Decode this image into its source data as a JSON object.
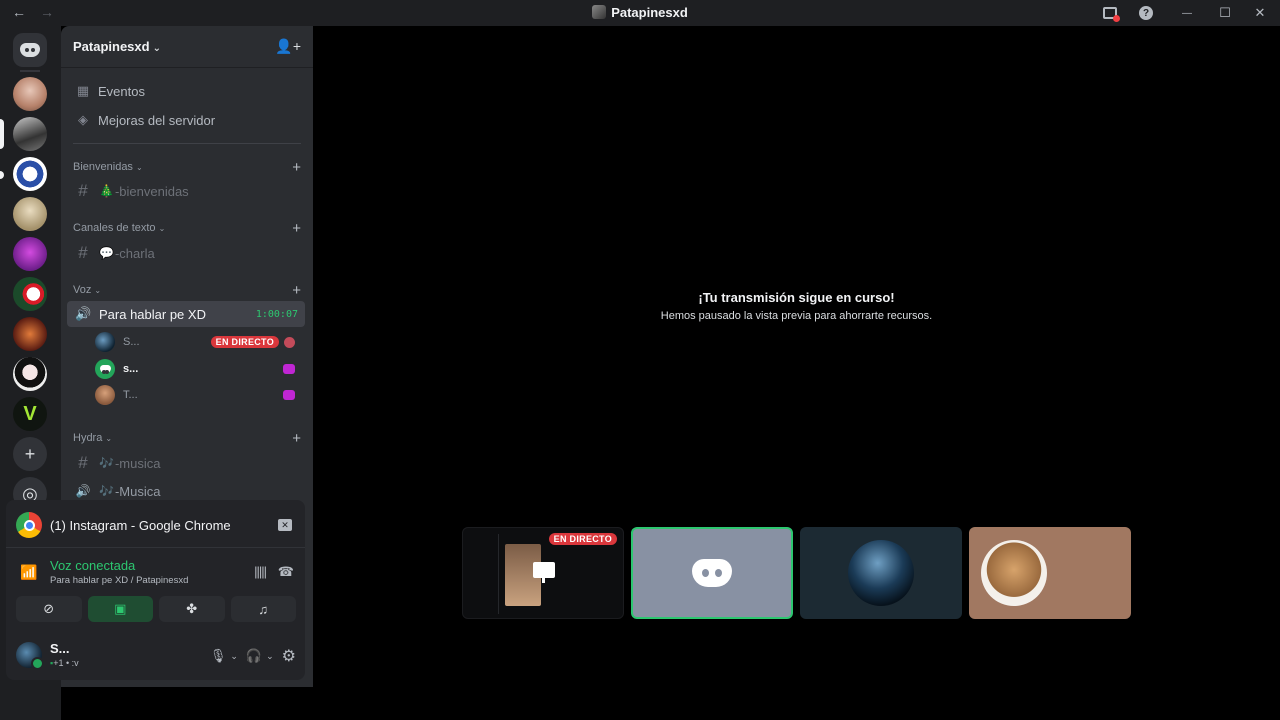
{
  "window": {
    "title": "Patapinesxd",
    "back_glyph": "←",
    "forward_glyph": "→",
    "minimize_glyph": "—",
    "maximize_glyph": "☐",
    "close_glyph": "✕",
    "help_glyph": "?"
  },
  "rail": {
    "add_glyph": "+",
    "discover_glyph": "◎"
  },
  "guild": {
    "name": "Patapinesxd",
    "chevron": "⌄",
    "invite_glyph": "👤+"
  },
  "nav": {
    "events_label": "Eventos",
    "boosts_label": "Mejoras del servidor"
  },
  "categories": [
    {
      "name": "Bienvenidas",
      "channels": [
        {
          "emoji": "🎄",
          "name": "-bienvenidas"
        }
      ]
    },
    {
      "name": "Canales de texto",
      "channels": [
        {
          "emoji": "💬",
          "name": "-charla"
        }
      ]
    },
    {
      "name": "Voz",
      "channels": [
        {
          "name": "Para hablar pe XD",
          "timer": "1:00:07"
        }
      ]
    },
    {
      "name": "Hydra",
      "channels": [
        {
          "emoji": "🎶",
          "name": "-musica"
        },
        {
          "emoji": "🎶",
          "name": "-Musica"
        }
      ]
    }
  ],
  "voice_users": [
    {
      "name": "S...",
      "live": "EN DIRECTO"
    },
    {
      "name": "s..."
    },
    {
      "name": "T..."
    }
  ],
  "panel": {
    "stream_title": "(1) Instagram - Google Chrome",
    "voice_status": "Voz conectada",
    "voice_sub": "Para hablar pe XD / Patapinesxd",
    "user_name": "S...",
    "user_status_count": "+1",
    "user_status_text": ":v"
  },
  "stage": {
    "paused_title": "¡Tu transmisión sigue en curso!",
    "paused_sub": "Hemos pausado la vista previa para ahorrarte recursos.",
    "tile_live": "EN DIRECTO"
  },
  "colors": {
    "accent_green": "#23a55a",
    "live_red": "#da373c",
    "background": "#000000",
    "sidebar": "#2b2d31"
  }
}
